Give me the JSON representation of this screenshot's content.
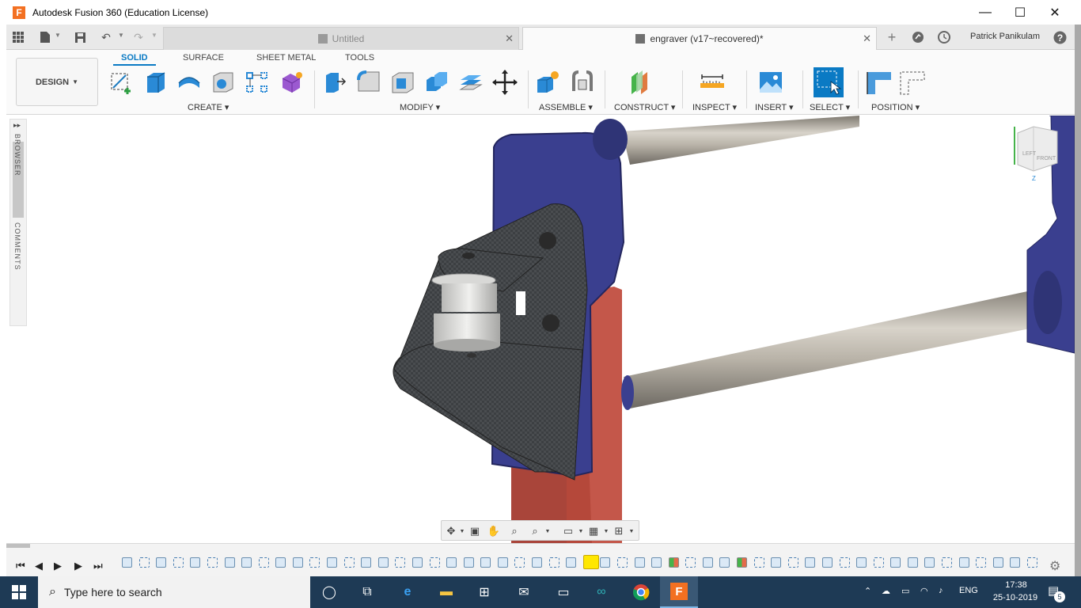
{
  "window": {
    "title": "Autodesk Fusion 360 (Education License)",
    "logo_letter": "F",
    "minimize": "—",
    "maximize": "☐",
    "close": "✕"
  },
  "tabs": [
    {
      "label": "Untitled",
      "active": false
    },
    {
      "label": "engraver (v17~recovered)*",
      "active": true
    }
  ],
  "user": {
    "name": "Patrick Panikulam"
  },
  "toolbar": {
    "workspace": "DESIGN",
    "workspace_tabs": [
      "SOLID",
      "SURFACE",
      "SHEET METAL",
      "TOOLS"
    ],
    "active_workspace_tab": "SOLID",
    "groups": [
      "CREATE",
      "MODIFY",
      "ASSEMBLE",
      "CONSTRUCT",
      "INSPECT",
      "INSERT",
      "SELECT",
      "POSITION"
    ]
  },
  "left_panel": {
    "browser_label": "BROWSER",
    "comments_label": "COMMENTS"
  },
  "viewcube": {
    "front_label": "FRONT",
    "left_label": "LEFT",
    "z_axis": "Z"
  },
  "timeline": {
    "play_controls": [
      "⏮",
      "◀",
      "▶",
      "▶",
      "⏭"
    ]
  },
  "taskbar": {
    "search_placeholder": "Type here to search",
    "language": "ENG",
    "time": "17:38",
    "date": "25-10-2019",
    "notification_count": "5"
  },
  "colors": {
    "accent": "#0a7ac4",
    "taskbar": "#1e3a55",
    "bracket_blue": "#3a3f8f",
    "frame_red": "#b5483a",
    "carbon": "#3c3f42",
    "rod": "#b8b2a6"
  }
}
